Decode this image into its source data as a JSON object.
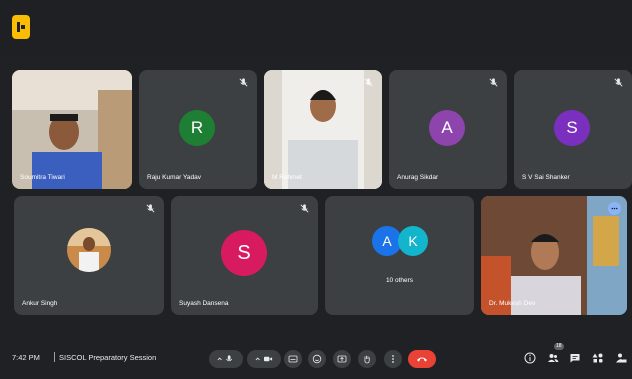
{
  "participants": [
    {
      "name": "Soumitra Tiwari",
      "type": "video"
    },
    {
      "name": "Raju Kumar Yadav",
      "type": "avatar",
      "initial": "R",
      "color": "#1e7f34",
      "muted": true
    },
    {
      "name": "M Rahmet",
      "type": "video",
      "muted": true
    },
    {
      "name": "Anurag Sikdar",
      "type": "avatar",
      "initial": "A",
      "color": "#8e44ad",
      "muted": true
    },
    {
      "name": "S V Sai Shanker",
      "type": "avatar",
      "initial": "S",
      "color": "#7b2fbf",
      "muted": true
    },
    {
      "name": "Ankur Singh",
      "type": "video-avatar",
      "muted": true
    },
    {
      "name": "Suyash Dansena",
      "type": "avatar",
      "initial": "S",
      "color": "#d81b60",
      "muted": true
    },
    {
      "name": "10 others",
      "type": "group",
      "initials": [
        "A",
        "K"
      ],
      "colors": [
        "#1a73e8",
        "#12b5cb"
      ]
    },
    {
      "name": "Dr. Mukesh Dev",
      "type": "video",
      "active": true
    }
  ],
  "footer": {
    "time": "7:42 PM",
    "meeting_name": "SISCOL Preparatory Session",
    "participant_count": "18"
  },
  "icons": {
    "app": "app-logo-icon",
    "mic_off": "mic-off-icon",
    "more": "more-vert-icon"
  },
  "colors": {
    "background": "#202124",
    "tile": "#3c4043",
    "accent": "#8ab4f8",
    "end_call": "#ea4335"
  }
}
